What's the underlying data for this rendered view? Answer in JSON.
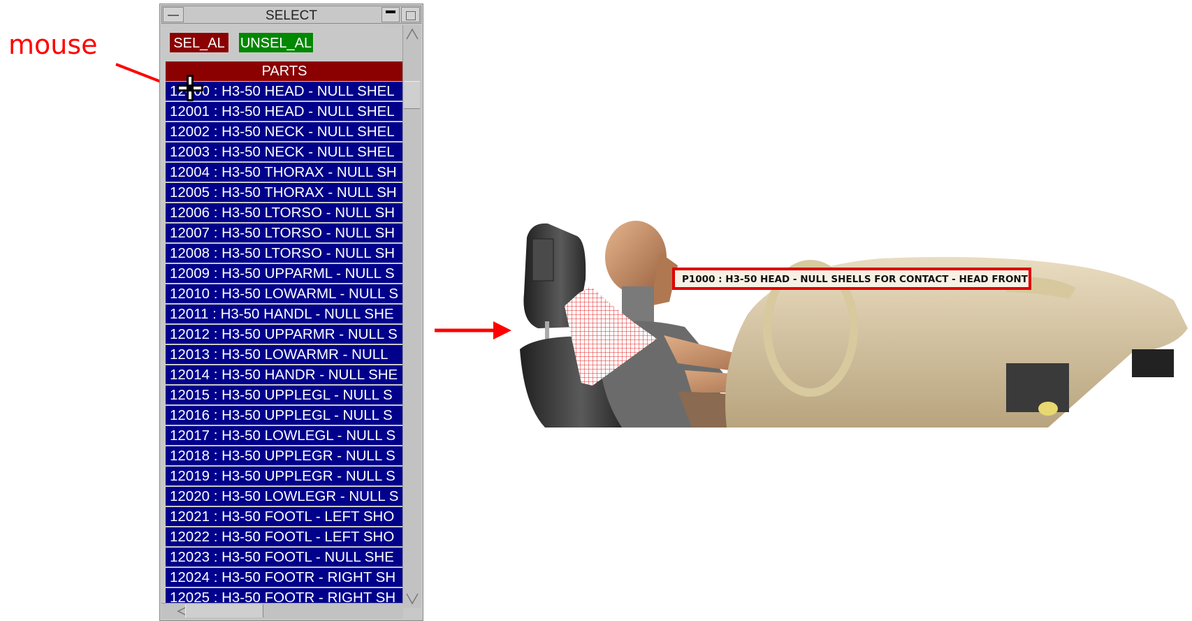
{
  "annotation": {
    "mouse_label": "mouse"
  },
  "panel": {
    "title": "SELECT",
    "sel_all_label": "SEL_AL",
    "unsel_all_label": "UNSEL_AL",
    "list_header": "PARTS",
    "items": [
      {
        "label": "12000 : H3-50 HEAD - NULL SHEL"
      },
      {
        "label": "12001 : H3-50 HEAD - NULL SHEL"
      },
      {
        "label": "12002 : H3-50 NECK - NULL SHEL"
      },
      {
        "label": "12003 : H3-50 NECK - NULL SHEL"
      },
      {
        "label": "12004 : H3-50 THORAX - NULL SH"
      },
      {
        "label": "12005 : H3-50 THORAX - NULL SH"
      },
      {
        "label": "12006 : H3-50 LTORSO - NULL SH"
      },
      {
        "label": "12007 : H3-50 LTORSO - NULL SH"
      },
      {
        "label": "12008 : H3-50 LTORSO - NULL SH"
      },
      {
        "label": "12009 : H3-50 UPPARML - NULL S"
      },
      {
        "label": "12010 : H3-50 LOWARML - NULL S"
      },
      {
        "label": "12011 : H3-50 HANDL - NULL SHE"
      },
      {
        "label": "12012 : H3-50 UPPARMR - NULL S"
      },
      {
        "label": "12013 : H3-50 LOWARMR - NULL"
      },
      {
        "label": "12014 : H3-50 HANDR - NULL SHE"
      },
      {
        "label": "12015 : H3-50 UPPLEGL - NULL S"
      },
      {
        "label": "12016 : H3-50 UPPLEGL - NULL S"
      },
      {
        "label": "12017 : H3-50 LOWLEGL - NULL S"
      },
      {
        "label": "12018 : H3-50 UPPLEGR - NULL S"
      },
      {
        "label": "12019 : H3-50 UPPLEGR - NULL S"
      },
      {
        "label": "12020 : H3-50 LOWLEGR - NULL S"
      },
      {
        "label": "12021 : H3-50 FOOTL - LEFT SHO"
      },
      {
        "label": "12022 : H3-50 FOOTL - LEFT SHO"
      },
      {
        "label": "12023 : H3-50 FOOTL - NULL SHE"
      },
      {
        "label": "12024 : H3-50 FOOTR - RIGHT SH"
      },
      {
        "label": "12025 : H3-50 FOOTR - RIGHT SH"
      }
    ]
  },
  "viewport": {
    "hover_label": "P1000 : H3-50 HEAD - NULL SHELLS FOR CONTACT - HEAD FRONT"
  },
  "colors": {
    "list_row_bg": "#00008b",
    "header_bg": "#8b0000",
    "select_all_bg": "#8b0000",
    "unselect_all_bg": "#008800",
    "annotation_red": "#ff0000"
  }
}
